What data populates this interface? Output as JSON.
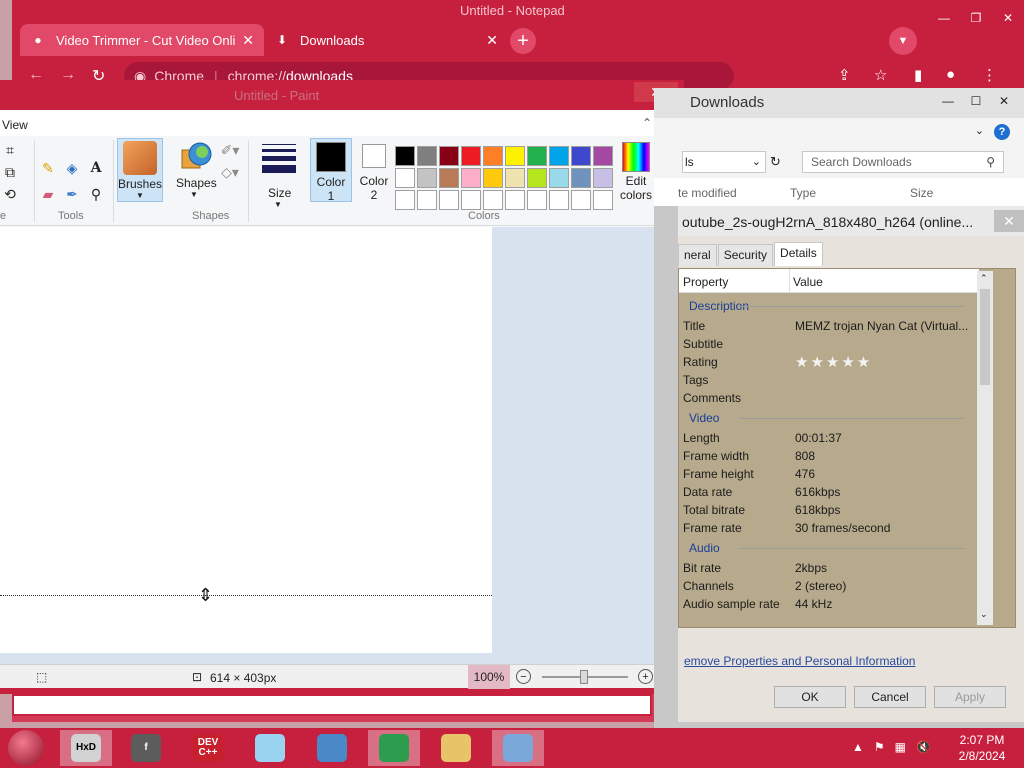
{
  "chrome": {
    "background_window_title": "Untitled - Notepad",
    "tabs": [
      {
        "label": "Video Trimmer - Cut Video Onlin",
        "icon": "colorful-dot-icon",
        "active": false
      },
      {
        "label": "Downloads",
        "icon": "download-icon",
        "active": true
      }
    ],
    "new_tab": "+",
    "address_site": "Chrome",
    "address_scheme": "chrome://",
    "address_path": "downloads",
    "accent": "#c7203f"
  },
  "paint": {
    "title": "Untitled - Paint",
    "view_tab": "View",
    "groups": {
      "image": "e",
      "tools": "Tools",
      "shapes": "Shapes",
      "colors": "Colors"
    },
    "brushes_label": "Brushes",
    "shapes_label": "Shapes",
    "size_label": "Size",
    "color1_label": "Color",
    "color1_num": "1",
    "color2_label": "Color",
    "color2_num": "2",
    "edit_colors_1": "Edit",
    "edit_colors_2": "colors",
    "palette": [
      "#000000",
      "#7f7f7f",
      "#880015",
      "#ed1c24",
      "#ff7f27",
      "#fff200",
      "#22b14c",
      "#00a2e8",
      "#3f48cc",
      "#a349a4",
      "#ffffff",
      "#c3c3c3",
      "#b97a57",
      "#ffaec9",
      "#ffc90e",
      "#efe4b0",
      "#b5e61d",
      "#99d9ea",
      "#7092be",
      "#c8bfe7",
      "#ffffff",
      "#ffffff",
      "#ffffff",
      "#ffffff",
      "#ffffff",
      "#ffffff",
      "#ffffff",
      "#ffffff",
      "#ffffff",
      "#ffffff"
    ],
    "status_size": "614 × 403px",
    "zoom": "100%"
  },
  "explorer": {
    "title": "Downloads",
    "crumb": "ls",
    "search_placeholder": "Search Downloads",
    "columns": [
      "te modified",
      "Type",
      "Size"
    ]
  },
  "properties": {
    "title": "outube_2s-ougH2rnA_818x480_h264 (online...",
    "tabs": [
      "neral",
      "Security",
      "Details"
    ],
    "active_tab": "Details",
    "header_property": "Property",
    "header_value": "Value",
    "sections": [
      {
        "title": "Description",
        "rows": [
          {
            "key": "Title",
            "value": "MEMZ trojan Nyan Cat (Virtual..."
          },
          {
            "key": "Subtitle",
            "value": ""
          },
          {
            "key": "Rating",
            "value": "★★★★★"
          },
          {
            "key": "Tags",
            "value": ""
          },
          {
            "key": "Comments",
            "value": ""
          }
        ]
      },
      {
        "title": "Video",
        "rows": [
          {
            "key": "Length",
            "value": "00:01:37"
          },
          {
            "key": "Frame width",
            "value": "808"
          },
          {
            "key": "Frame height",
            "value": "476"
          },
          {
            "key": "Data rate",
            "value": "616kbps"
          },
          {
            "key": "Total bitrate",
            "value": "618kbps"
          },
          {
            "key": "Frame rate",
            "value": "30 frames/second"
          }
        ]
      },
      {
        "title": "Audio",
        "rows": [
          {
            "key": "Bit rate",
            "value": "2kbps"
          },
          {
            "key": "Channels",
            "value": "2 (stereo)"
          },
          {
            "key": "Audio sample rate",
            "value": "44 kHz"
          }
        ]
      }
    ],
    "remove_link": "emove Properties and Personal Information",
    "ok": "OK",
    "cancel": "Cancel",
    "apply": "Apply"
  },
  "taskbar": {
    "apps": [
      {
        "name": "hxd-app",
        "label": "HxD"
      },
      {
        "name": "flash-app",
        "label": "f"
      },
      {
        "name": "devcpp-app",
        "label": "DEV C++"
      },
      {
        "name": "notepad-app",
        "label": ""
      },
      {
        "name": "control-panel-app",
        "label": ""
      },
      {
        "name": "chrome-app",
        "label": ""
      },
      {
        "name": "explorer-app",
        "label": ""
      },
      {
        "name": "paint-app",
        "label": ""
      }
    ],
    "time": "2:07 PM",
    "date": "2/8/2024"
  }
}
